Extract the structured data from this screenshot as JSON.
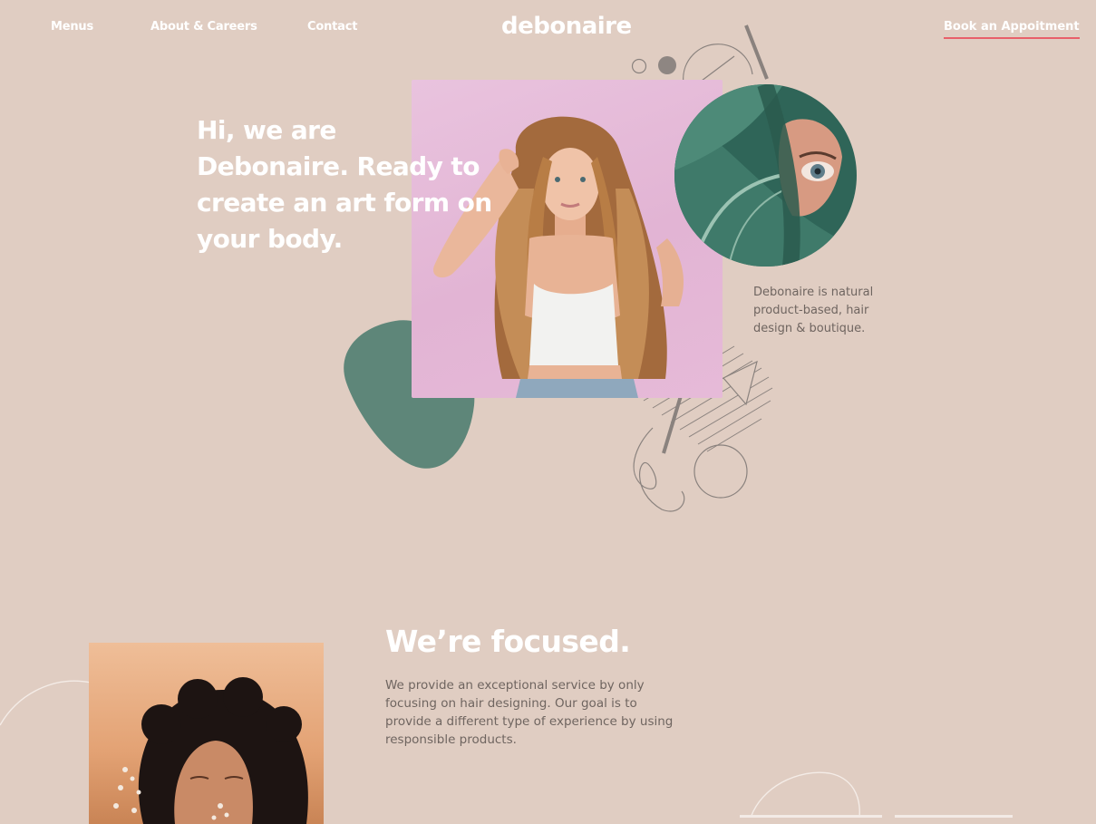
{
  "nav": {
    "menus": "Menus",
    "about": "About & Careers",
    "contact": "Contact",
    "logo": "debonaire",
    "cta": "Book an Appoitment"
  },
  "hero": {
    "title": "Hi, we are Debonaire. Ready to create an art form on your body.",
    "side_text": "Debonaire is natural product-based, hair design & boutique."
  },
  "focus": {
    "title": "We’re focused.",
    "body": "We provide an exceptional service by only focusing on hair designing. Our goal is to provide a different type of experience by using responsible products."
  },
  "colors": {
    "background": "#e0cdc2",
    "accent_underline": "#e8606a",
    "blob_green": "#5e8679",
    "hero_photo_pink": "#e4b9d6"
  }
}
